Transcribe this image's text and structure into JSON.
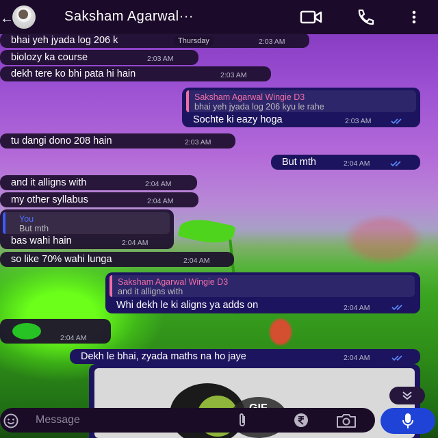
{
  "header": {
    "back_glyph": "←",
    "contact_name": "Saksham Agarwal···"
  },
  "day_label": "Thursday",
  "messages": [
    {
      "text": "bhai yeh jyada log 206 k",
      "time": "2:03 AM"
    },
    {
      "text": "biolozy ka course",
      "time": "2:03 AM"
    },
    {
      "text": "dekh tere ko bhi pata hi hain",
      "time": "2:03 AM"
    },
    {
      "quote_name": "Saksham Agarwal Wingie D3",
      "quote_text": "bhai yeh jyada log 206 kyu le rahe",
      "text": "Sochte ki eazy hoga",
      "time": "2:03 AM"
    },
    {
      "text": "tu dangi dono 208 hain",
      "time": "2:03 AM"
    },
    {
      "text": "But mth",
      "time": "2:04 AM"
    },
    {
      "text": "and it alligns with",
      "time": "2:04 AM"
    },
    {
      "text": "my other syllabus",
      "time": "2:04 AM"
    },
    {
      "quote_name": "You",
      "quote_text": "But mth",
      "text": "bas wahi hain",
      "time": "2:04 AM"
    },
    {
      "text": "so like 70% wahi lunga",
      "time": "2:04 AM"
    },
    {
      "quote_name": "Saksham Agarwal Wingie D3",
      "quote_text": "and it alligns with",
      "text": "Whi dekh le ki aligns ya adds on",
      "time": "2:04 AM"
    },
    {
      "text": "",
      "time": "2:04 AM"
    },
    {
      "text": "Dekh le bhai, zyada maths na ho jaye",
      "time": "2:04 AM"
    }
  ],
  "gif_label": "GIF",
  "composer": {
    "placeholder": "Message"
  },
  "colors": {
    "header_bg": "#1b0a2a",
    "incoming_bubble": "#1c0e2c",
    "outgoing_bubble": "#1d145f",
    "quote_name_pink": "#ef6fa4",
    "read_ticks": "#5b8cff",
    "mic_button": "#1f43d6"
  },
  "icons": [
    "back-arrow-icon",
    "video-call-icon",
    "voice-call-icon",
    "more-options-icon",
    "read-ticks-icon",
    "sticker-icon",
    "chevron-down-icon",
    "emoji-icon",
    "attach-icon",
    "rupee-payment-icon",
    "camera-icon",
    "mic-icon"
  ]
}
